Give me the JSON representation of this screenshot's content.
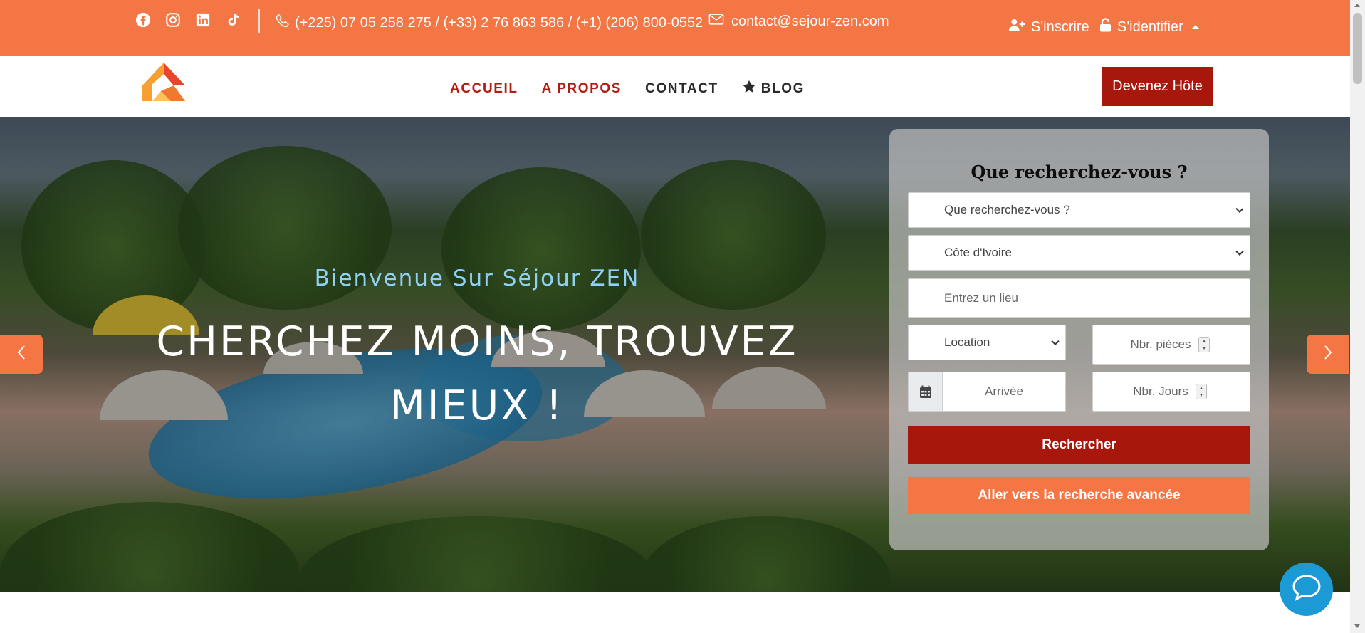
{
  "colors": {
    "accent_orange": "#f47645",
    "brand_red": "#a8170c",
    "nav_red": "#b31c10",
    "chat_blue": "#1c9ad6",
    "welcome_blue": "#8fd1f2"
  },
  "topbar": {
    "socials": [
      "facebook-icon",
      "instagram-icon",
      "linkedin-icon",
      "tiktok-icon"
    ],
    "phone": "(+225) 07 05 258 275 / (+33) 2 76 863 586 / (+1) (206) 800-0552",
    "email": "contact@sejour-zen.com",
    "register": "S'inscrire",
    "login": "S'identifier"
  },
  "nav": {
    "items": [
      {
        "label": "ACCUEIL"
      },
      {
        "label": "A PROPOS"
      },
      {
        "label": "CONTACT"
      },
      {
        "label": "BLOG",
        "icon": "star-icon"
      }
    ],
    "host_button": "Devenez Hôte"
  },
  "hero": {
    "welcome": "Bienvenue Sur Séjour ZEN",
    "headline_line1": "CHERCHEZ MOINS, TROUVEZ",
    "headline_line2": "MIEUX !"
  },
  "search": {
    "title": "Que recherchez-vous ?",
    "type_select": "Que recherchez-vous ?",
    "country_select": "Côte d'Ivoire",
    "place_placeholder": "Entrez un lieu",
    "mode_select": "Location",
    "rooms_placeholder": "Nbr. pièces",
    "arrival_placeholder": "Arrivée",
    "days_placeholder": "Nbr. Jours",
    "search_button": "Rechercher",
    "advanced_button": "Aller vers la recherche avancée"
  }
}
